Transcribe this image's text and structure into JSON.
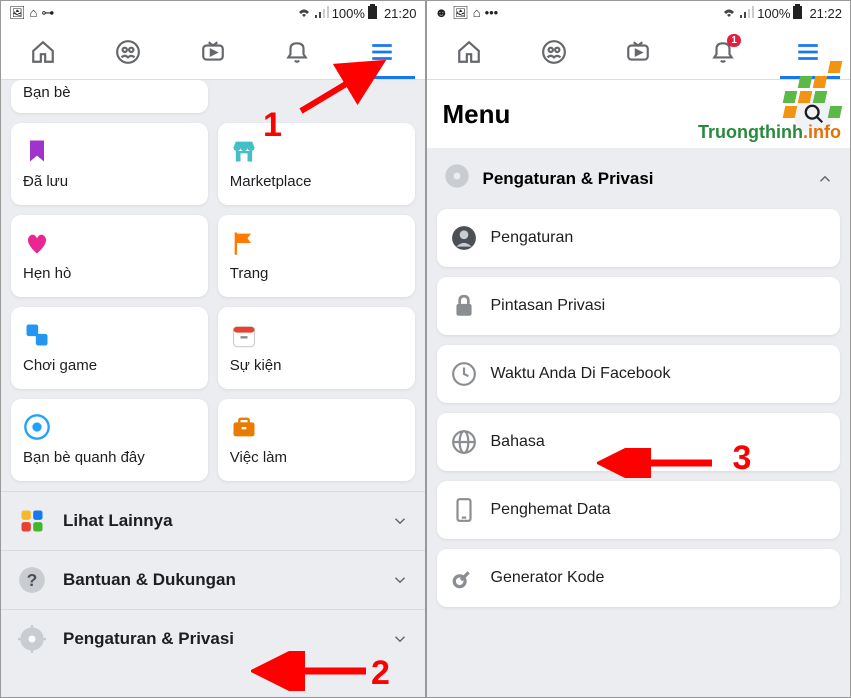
{
  "left": {
    "status": {
      "battery": "100%",
      "time": "21:20"
    },
    "clipped_card": "Bạn bè",
    "cards": [
      {
        "label": "Đã lưu"
      },
      {
        "label": "Marketplace"
      },
      {
        "label": "Hẹn hò"
      },
      {
        "label": "Trang"
      },
      {
        "label": "Chơi game"
      },
      {
        "label": "Sự kiện"
      },
      {
        "label": "Bạn bè quanh đây"
      },
      {
        "label": "Việc làm"
      }
    ],
    "rows": [
      {
        "label": "Lihat Lainnya"
      },
      {
        "label": "Bantuan & Dukungan"
      },
      {
        "label": "Pengaturan & Privasi"
      }
    ],
    "annot1": "1",
    "annot2": "2"
  },
  "right": {
    "status": {
      "battery": "100%",
      "time": "21:22"
    },
    "notif_badge": "1",
    "title": "Menu",
    "section": "Pengaturan & Privasi",
    "items": [
      {
        "label": "Pengaturan"
      },
      {
        "label": "Pintasan Privasi"
      },
      {
        "label": "Waktu Anda Di Facebook"
      },
      {
        "label": "Bahasa"
      },
      {
        "label": "Penghemat Data"
      },
      {
        "label": "Generator Kode"
      }
    ],
    "annot3": "3"
  },
  "watermark": {
    "text1": "Truongthinh",
    "text2": ".info"
  }
}
